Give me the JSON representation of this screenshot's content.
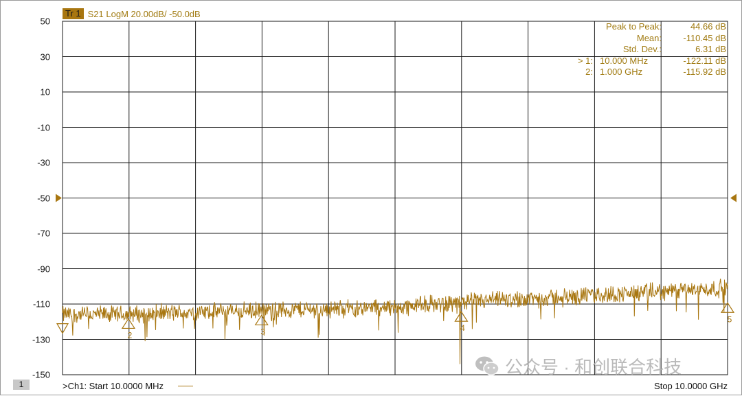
{
  "trace": {
    "badge": "Tr 1",
    "title": "S21 LogM 20.00dB/  -50.0dB",
    "color": "#a87610"
  },
  "stats": [
    {
      "label": "Peak to Peak:",
      "value": "44.66 dB"
    },
    {
      "label": "Mean:",
      "value": "-110.45 dB"
    },
    {
      "label": "Std. Dev.:",
      "value": "6.31 dB"
    }
  ],
  "markers_table": [
    {
      "id": "> 1:",
      "x": "10.000  MHz",
      "y": "-122.11 dB"
    },
    {
      "id": "2:",
      "x": "1.000  GHz",
      "y": "-115.92 dB"
    }
  ],
  "footer": {
    "channel_box": "1",
    "start": ">Ch1:  Start  10.0000 MHz",
    "stop": "Stop  10.0000 GHz"
  },
  "watermark": {
    "icon": "wechat-icon",
    "text": "公众号 · 和创联合科技"
  },
  "chart_data": {
    "type": "line",
    "x_start_ghz": 0.01,
    "x_stop_ghz": 10.0,
    "ylim": [
      -150,
      50
    ],
    "y_ticks": [
      50,
      30,
      10,
      -10,
      -30,
      -50,
      -70,
      -90,
      -110,
      -130,
      -150
    ],
    "x_divisions": 10,
    "reference_level": -50,
    "grid": true,
    "noise_amplitude_db": 6,
    "series": [
      {
        "color": "#a87610",
        "x_ghz": [
          0.01,
          0.5,
          1.0,
          1.5,
          2.0,
          2.5,
          3.0,
          3.5,
          4.0,
          4.5,
          5.0,
          5.5,
          6.0,
          6.5,
          7.0,
          7.5,
          8.0,
          8.5,
          9.0,
          9.5,
          10.0
        ],
        "y_db": [
          -116,
          -116,
          -116,
          -115,
          -115,
          -114,
          -114,
          -113,
          -113,
          -112,
          -112,
          -110,
          -109,
          -108,
          -107,
          -106,
          -105,
          -104,
          -103,
          -102,
          -101
        ]
      }
    ],
    "spikes": [
      {
        "x_ghz": 1.25,
        "y_db": -131
      },
      {
        "x_ghz": 2.45,
        "y_db": -130
      },
      {
        "x_ghz": 3.85,
        "y_db": -129
      },
      {
        "x_ghz": 5.98,
        "y_db": -144
      },
      {
        "x_ghz": 7.4,
        "y_db": -118
      },
      {
        "x_ghz": 8.6,
        "y_db": -117
      }
    ],
    "markers": [
      {
        "label": "1",
        "x_ghz": 0.01,
        "y_db": -118
      },
      {
        "label": "2",
        "x_ghz": 1.0,
        "y_db": -116
      },
      {
        "label": "3",
        "x_ghz": 3.0,
        "y_db": -114
      },
      {
        "label": "4",
        "x_ghz": 6.0,
        "y_db": -112
      },
      {
        "label": "5",
        "x_ghz": 10.0,
        "y_db": -107
      }
    ]
  }
}
